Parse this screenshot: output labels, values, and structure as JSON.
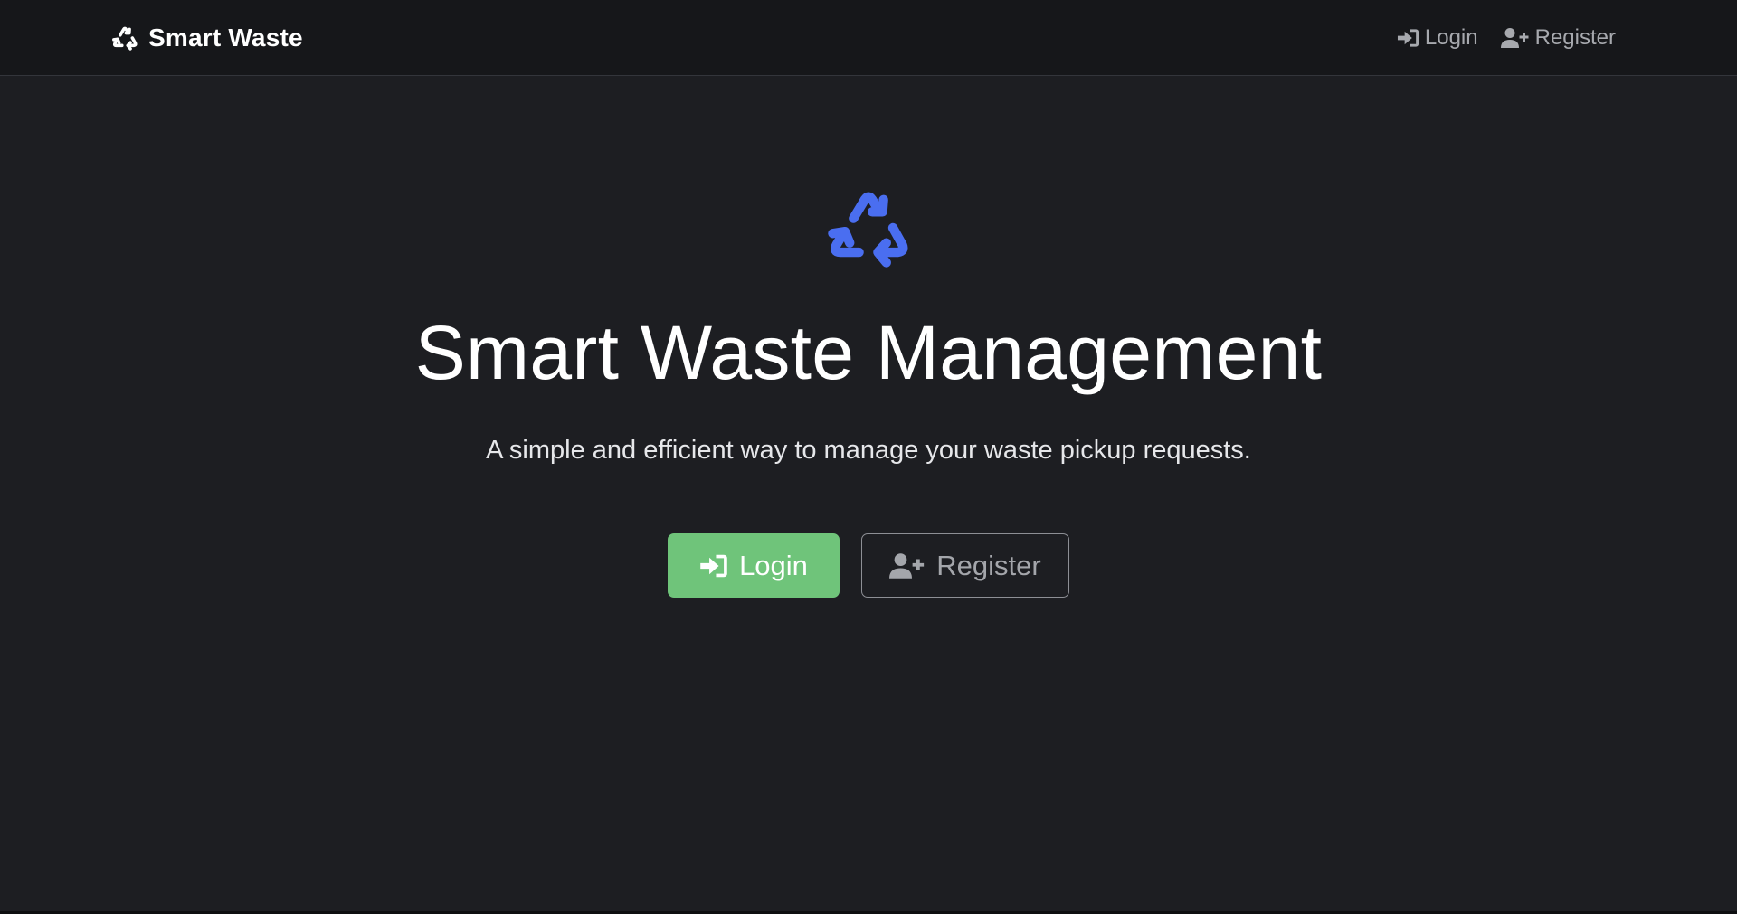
{
  "navbar": {
    "brand_text": "Smart Waste",
    "brand_icon": "recycle-icon",
    "links": [
      {
        "label": "Login",
        "icon": "sign-in-icon"
      },
      {
        "label": "Register",
        "icon": "user-plus-icon"
      }
    ]
  },
  "hero": {
    "icon": "recycle-icon",
    "title": "Smart Waste Management",
    "subtitle": "A simple and efficient way to manage your waste pickup requests.",
    "login_button": {
      "label": "Login",
      "icon": "sign-in-icon"
    },
    "register_button": {
      "label": "Register",
      "icon": "user-plus-icon"
    }
  },
  "colors": {
    "background": "#1d1e22",
    "navbar": "#16171a",
    "accent_blue": "#4a6ef0",
    "success_green": "#6fc47a",
    "muted_text": "#a7a9ae"
  }
}
